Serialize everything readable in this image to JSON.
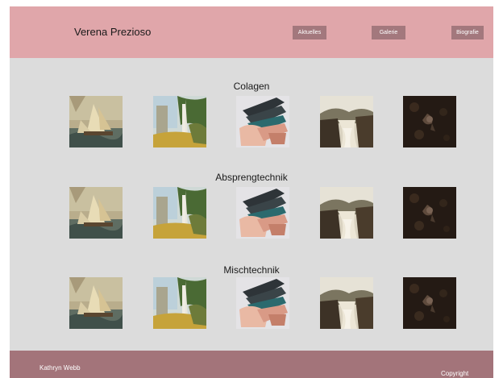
{
  "header": {
    "site_title": "Verena Prezioso",
    "nav": [
      {
        "label": "Aktuelles"
      },
      {
        "label": "Galerie"
      },
      {
        "label": "Biografie"
      }
    ]
  },
  "sections": [
    {
      "title": "Colagen",
      "images": [
        "ship-painting",
        "forest-painting",
        "hands-painting",
        "waterfall-painting",
        "dark-floral-painting"
      ]
    },
    {
      "title": "Absprengtechnik",
      "images": [
        "ship-painting",
        "forest-painting",
        "hands-painting",
        "waterfall-painting",
        "dark-floral-painting"
      ]
    },
    {
      "title": "Mischtechnik",
      "images": [
        "ship-painting",
        "forest-painting",
        "hands-painting",
        "waterfall-painting",
        "dark-floral-painting"
      ]
    }
  ],
  "footer": {
    "name": "Kathryn Webb",
    "copyright": "Copyright"
  },
  "colors": {
    "header_bg": "#e0a6aa",
    "nav_button_bg": "#a3787d",
    "content_bg": "#dcdcdc",
    "footer_bg": "#a3747a"
  }
}
